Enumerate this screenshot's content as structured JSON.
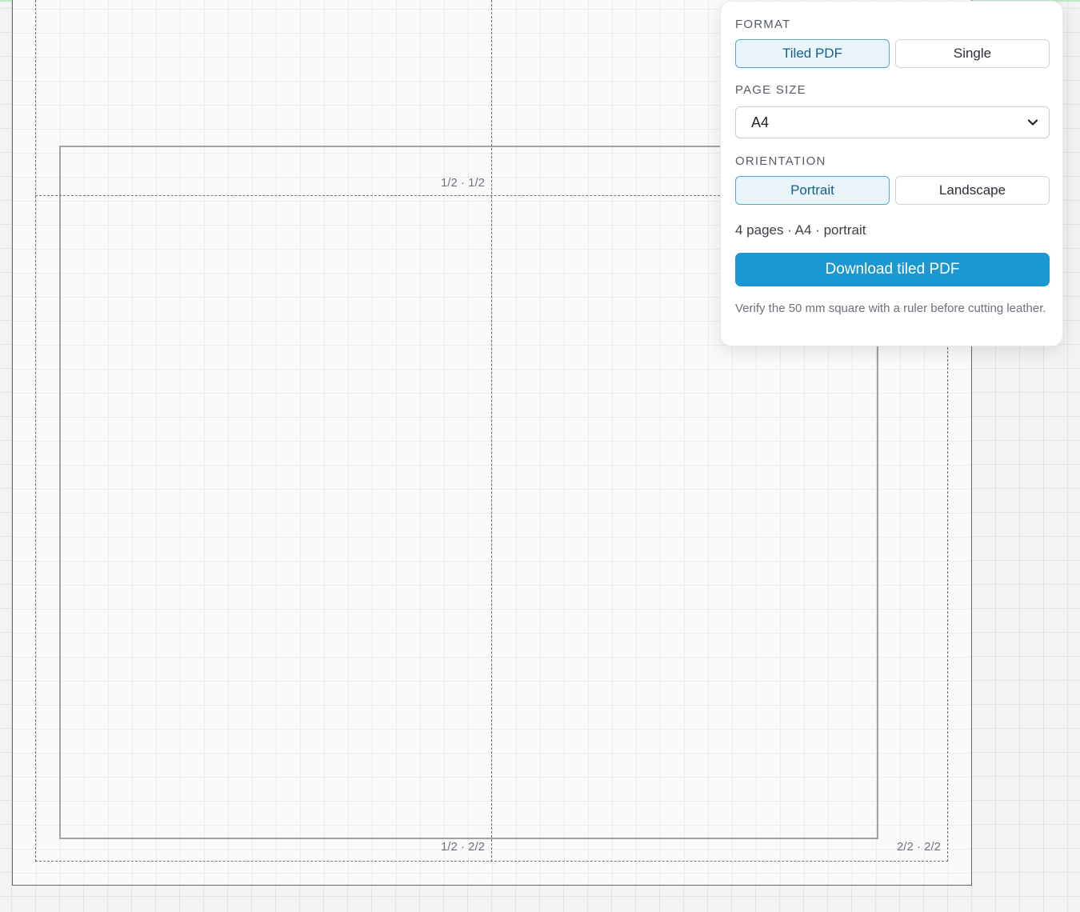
{
  "canvas": {
    "tiles": [
      {
        "label": "1/2 · 1/2"
      },
      {
        "label": "1/2 · 2/2"
      },
      {
        "label": "2/2 · 2/2"
      }
    ]
  },
  "export_panel": {
    "format": {
      "label": "FORMAT",
      "options": [
        {
          "label": "Tiled PDF",
          "selected": true
        },
        {
          "label": "Single",
          "selected": false
        }
      ]
    },
    "page_size": {
      "label": "PAGE SIZE",
      "value": "A4"
    },
    "orientation": {
      "label": "ORIENTATION",
      "options": [
        {
          "label": "Portrait",
          "selected": true
        },
        {
          "label": "Landscape",
          "selected": false
        }
      ]
    },
    "summary": "4 pages · A4 · portrait",
    "download_label": "Download tiled PDF",
    "note": "Verify the 50 mm square with a ruler before cutting leather."
  },
  "colors": {
    "accent": "#1b97d4",
    "selected_border": "#52a7d6",
    "selected_bg": "#eaf5fb"
  },
  "icons": {
    "select_chevron": "chevron-down-icon"
  }
}
